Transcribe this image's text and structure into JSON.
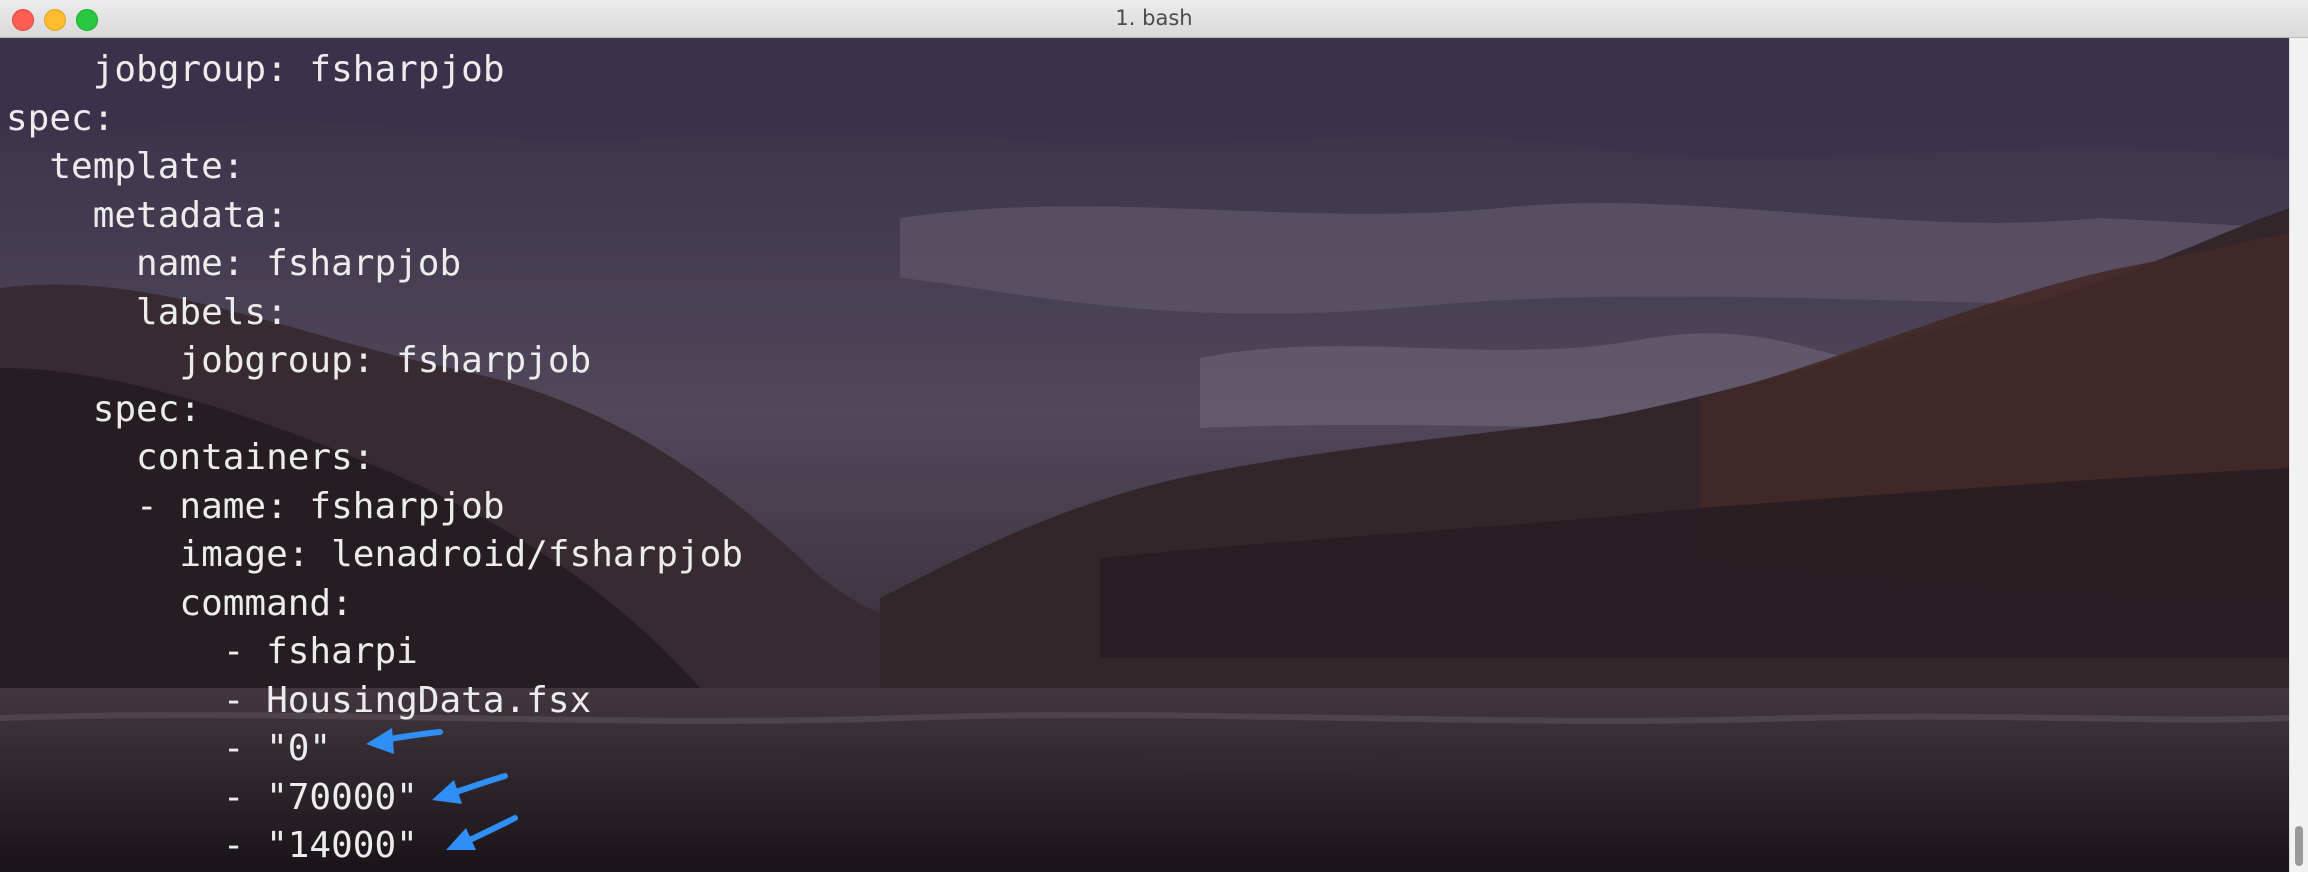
{
  "window": {
    "title": "1. bash"
  },
  "terminal": {
    "lines": [
      "    jobgroup: fsharpjob",
      "spec:",
      "  template:",
      "    metadata:",
      "      name: fsharpjob",
      "      labels:",
      "        jobgroup: fsharpjob",
      "    spec:",
      "      containers:",
      "      - name: fsharpjob",
      "        image: lenadroid/fsharpjob",
      "        command:",
      "          - fsharpi",
      "          - HousingData.fsx",
      "          - \"0\"",
      "          - \"70000\"",
      "          - \"14000\""
    ]
  },
  "annotations": {
    "arrow_color": "#2f8ff5",
    "arrow_icon": "arrow-left-icon"
  },
  "colors": {
    "text": "#ececec",
    "background_dark": "#241d24",
    "background_mid": "#5c4c5e"
  }
}
